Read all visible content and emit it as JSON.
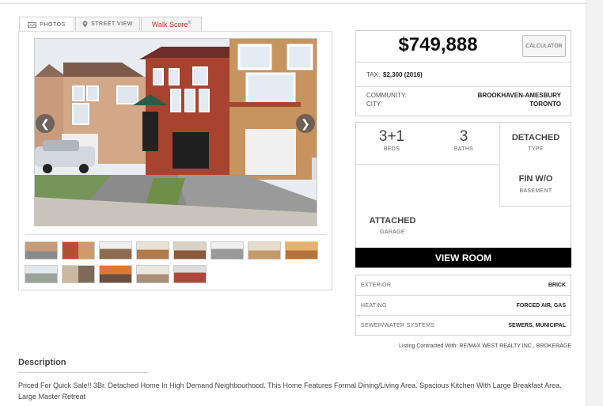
{
  "tabs": {
    "photos": "PHOTOS",
    "street_view": "STREET VIEW",
    "walk_score": "Walk Score",
    "walk_score_mark": "®"
  },
  "listing": {
    "price": "$749,888",
    "calculator_label": "CALCULATOR",
    "tax_label": "TAX:",
    "tax_value": "$2,300 (2016)",
    "community_label": "COMMUNITY:",
    "community_value": "BROOKHAVEN-AMESBURY",
    "city_label": "CITY:",
    "city_value": "TORONTO"
  },
  "facts": {
    "beds_value": "3+1",
    "beds_label": "BEDS",
    "baths_value": "3",
    "baths_label": "BATHS",
    "type_value": "DETACHED",
    "type_label": "TYPE",
    "basement_value": "FIN W/O",
    "basement_label": "BASEMENT",
    "garage_value": "ATTACHED",
    "garage_label": "GARAGE"
  },
  "view_room_label": "VIEW ROOM",
  "details": [
    {
      "label": "EXTERIOR",
      "value": "BRICK"
    },
    {
      "label": "HEATING",
      "value": "FORCED AIR, GAS"
    },
    {
      "label": "SEWER/WATER SYSTEMS",
      "value": "SEWERS, MUNICIPAL"
    }
  ],
  "contracted_with": "Listing Contracted With: RE/MAX WEST REALTY INC., BROKERAGE",
  "description": {
    "title": "Description",
    "text": "Priced For Quick Sale!! 3Br. Detached Home In High Demand Neighbourhood. This Home Features Formal Dining/Living Area. Spacious Kitchen With Large Breakfast Area. Large Master Retreat"
  },
  "icons": {
    "photos": "camera-icon",
    "street_view": "map-pin-icon",
    "prev": "chevron-left-icon",
    "next": "chevron-right-icon"
  },
  "colors": {
    "walk_score": "#c0392b",
    "view_room_bg": "#000000"
  },
  "thumbnail_count": 14
}
